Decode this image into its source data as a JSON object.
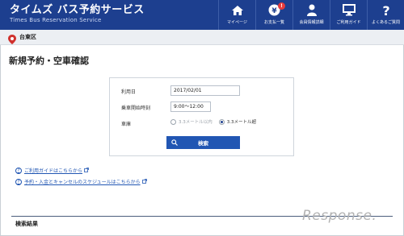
{
  "header": {
    "title": "タイムズ バス予約サービス",
    "subtitle": "Times Bus Reservation Service",
    "nav": [
      {
        "label": "マイページ",
        "icon": "home-icon"
      },
      {
        "label": "お支払一覧",
        "icon": "yen-icon",
        "badge": "!"
      },
      {
        "label": "会員情報詳細",
        "icon": "person-icon"
      },
      {
        "label": "ご利用ガイド",
        "icon": "monitor-icon"
      },
      {
        "label": "よくあるご質問",
        "icon": "question-icon"
      }
    ],
    "brand_color": "#1d3f8f"
  },
  "area": {
    "label": "台東区",
    "icon": "location-pin-icon"
  },
  "page": {
    "title": "新規予約・空車確認"
  },
  "form": {
    "date_label": "利用日",
    "date_value": "2017/02/01",
    "time_label": "乗車開始時刻",
    "time_value": "9:00〜12:00",
    "vehicle_label": "車庫",
    "option_1": "3.3メートル以内",
    "option_2": "3.3メートル超",
    "selected_option": "3.3メートル超",
    "search_label": "検索",
    "accent_color": "#2156b3"
  },
  "help_links": [
    {
      "label": "ご利用ガイドはこちらから"
    },
    {
      "label": "予約・入金とキャンセルのスケジュールはこちらから"
    }
  ],
  "results": {
    "heading": "検索結果"
  },
  "watermark": "Response."
}
